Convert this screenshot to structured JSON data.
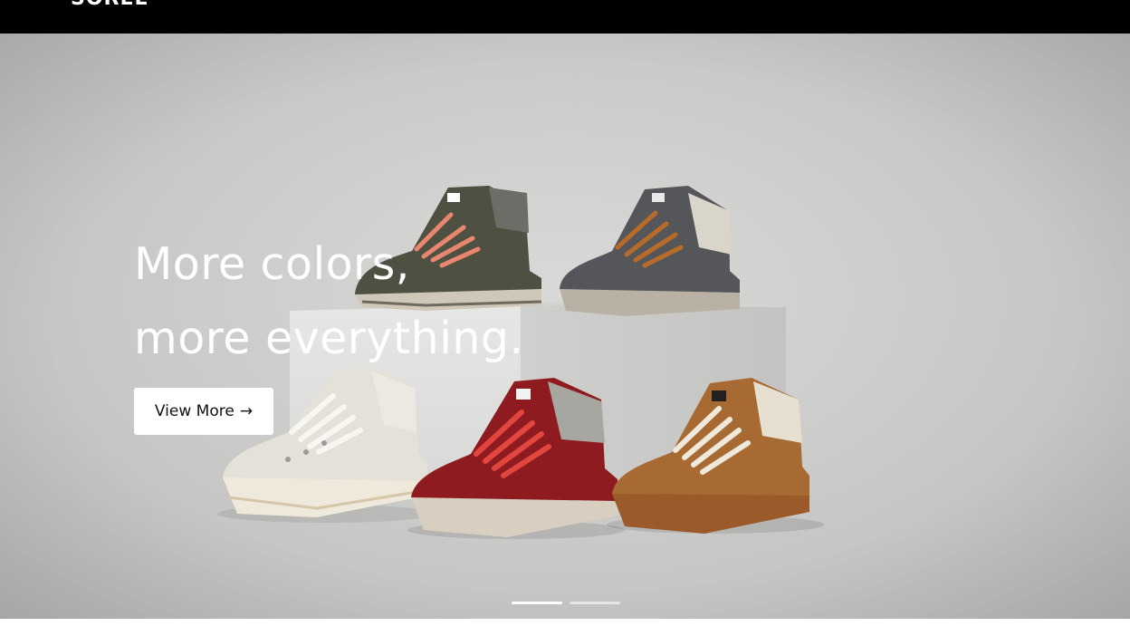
{
  "header": {
    "logo_text": "SOREL"
  },
  "hero": {
    "headline_line1": "More colors,",
    "headline_line2": "more everything.",
    "cta_label": "View More",
    "cta_arrow": "→",
    "image_alt": "Five hiking boots in olive, gray, white, red and brown displayed on a white pedestal",
    "slides": {
      "count": 2,
      "active_index": 1
    }
  },
  "colors": {
    "topbar": "#000000",
    "cta_background": "#ffffff",
    "boot_olive": "#4e5141",
    "boot_gray": "#55565a",
    "boot_white": "#e4e1d8",
    "boot_red": "#8e1b20",
    "boot_brown": "#a86a33"
  }
}
